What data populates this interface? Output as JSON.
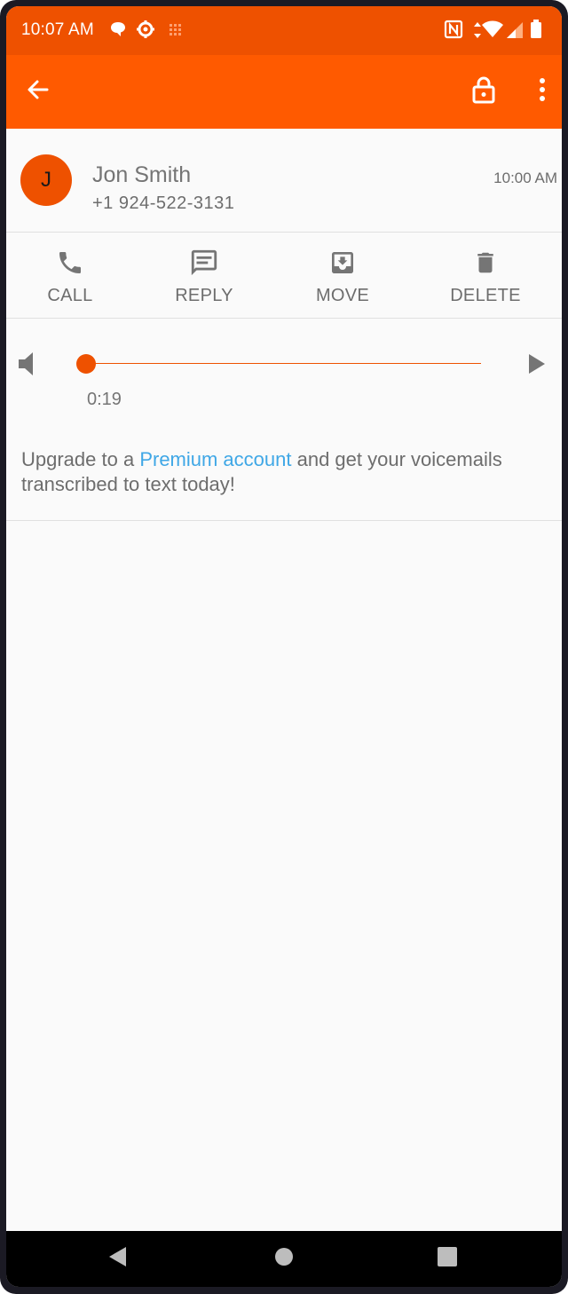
{
  "status_bar": {
    "time": "10:07 AM",
    "icons": [
      "chat-bubble-icon",
      "settings-gear-icon",
      "grid-dots-icon",
      "nfc-icon",
      "data-arrows-icon",
      "wifi-icon",
      "cell-signal-icon",
      "battery-icon"
    ]
  },
  "toolbar": {
    "back_icon": "arrow-left-icon",
    "lock_icon": "lock-icon",
    "more_icon": "more-vert-icon"
  },
  "contact": {
    "avatar_initial": "J",
    "name": "Jon Smith",
    "number": "+1 924-522-3131",
    "time": "10:00 AM"
  },
  "actions": [
    {
      "label": "CALL",
      "icon": "phone-icon"
    },
    {
      "label": "REPLY",
      "icon": "message-icon"
    },
    {
      "label": "MOVE",
      "icon": "move-to-inbox-icon"
    },
    {
      "label": "DELETE",
      "icon": "trash-icon"
    }
  ],
  "player": {
    "elapsed": "0:19",
    "progress": 0
  },
  "upgrade": {
    "before": "Upgrade to a ",
    "link": "Premium account",
    "after": " and get your voicemails transcribed to text today!"
  },
  "colors": {
    "status_bar": "#ee5100",
    "toolbar": "#ff5a00",
    "accent": "#ee5100",
    "link": "#3fa7e6"
  }
}
